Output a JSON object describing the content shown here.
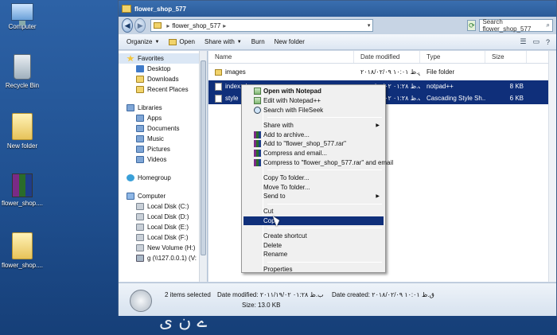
{
  "desktop": {
    "icons": [
      {
        "label": "Computer",
        "icon": "computer-icon"
      },
      {
        "label": "Recycle Bin",
        "icon": "recycle-bin-icon"
      },
      {
        "label": "New folder",
        "icon": "folder-icon"
      },
      {
        "label": "flower_shop....",
        "icon": "rar-archive-icon"
      },
      {
        "label": "flower_shop....",
        "icon": "folder-icon"
      }
    ]
  },
  "window": {
    "title": "flower_shop_577",
    "address": {
      "folder": "flower_shop_577",
      "separator": "▸",
      "dropdown": "▾"
    },
    "search_placeholder": "Search flower_shop_577",
    "toolbar": {
      "organize": "Organize",
      "open": "Open",
      "share_with": "Share with",
      "burn": "Burn",
      "new_folder": "New folder"
    }
  },
  "navpane": {
    "favorites": {
      "label": "Favorites",
      "items": [
        "Desktop",
        "Downloads",
        "Recent Places"
      ]
    },
    "libraries": {
      "label": "Libraries",
      "items": [
        "Apps",
        "Documents",
        "Music",
        "Pictures",
        "Videos"
      ]
    },
    "homegroup": "Homegroup",
    "computer": {
      "label": "Computer",
      "items": [
        "Local Disk (C:)",
        "Local Disk (D:)",
        "Local Disk (E:)",
        "Local Disk (F:)",
        "New Volume (H:)",
        "g (\\\\127.0.0.1) (V:"
      ]
    }
  },
  "filelist": {
    "columns": {
      "name": "Name",
      "date": "Date modified",
      "type": "Type",
      "size": "Size"
    },
    "rows": [
      {
        "name": "images",
        "date": "۲۰۱۸/۰۲/۰۹ ۱۰:۰۱ ق.ظ",
        "type": "File folder",
        "size": ""
      },
      {
        "name": "index.php",
        "date": "۲۰۱۱/۱۹/۰۲ ۰۱:۲۸ ب.ظ",
        "type": "notpad++",
        "size": "8 KB"
      },
      {
        "name": "style",
        "date": "۲۰۱۱/۱۹/۰۲ ۰۱:۲۸ ب.ظ",
        "type": "Cascading Style Sh...",
        "size": "6 KB"
      }
    ]
  },
  "context_menu": {
    "items": [
      {
        "label": "Open with Notepad",
        "bold": true,
        "icon": "notepad-icon"
      },
      {
        "label": "Edit with Notepad++",
        "icon": "notepadpp-icon"
      },
      {
        "label": "Search with FileSeek",
        "icon": "fileseek-icon"
      },
      {
        "sep": true
      },
      {
        "label": "Share with",
        "submenu": true
      },
      {
        "label": "Add to archive...",
        "icon": "rar-icon"
      },
      {
        "label": "Add to \"flower_shop_577.rar\"",
        "icon": "rar-icon"
      },
      {
        "label": "Compress and email...",
        "icon": "rar-icon"
      },
      {
        "label": "Compress to \"flower_shop_577.rar\" and email",
        "icon": "rar-icon"
      },
      {
        "sep": true
      },
      {
        "label": "Copy To folder..."
      },
      {
        "label": "Move To folder..."
      },
      {
        "label": "Send to",
        "submenu": true
      },
      {
        "sep": true
      },
      {
        "label": "Cut"
      },
      {
        "label": "Copy",
        "highlighted": true
      },
      {
        "sep": true
      },
      {
        "label": "Create shortcut"
      },
      {
        "label": "Delete"
      },
      {
        "label": "Rename"
      },
      {
        "sep": true
      },
      {
        "label": "Properties"
      }
    ]
  },
  "details": {
    "items_selected": "2 items selected",
    "date_modified_label": "Date modified:",
    "date_modified_value": "۲۰۱۱/۱۹/۰۲ ب.ظ ۰۱:۲۸",
    "date_created_label": "Date created:",
    "date_created_value": "۲۰۱۸/۰۲/۰۹ ق.ظ ۱۰:۰۱",
    "size": "Size: 13.0 KB"
  },
  "desktop_decor": "ے ن ی"
}
